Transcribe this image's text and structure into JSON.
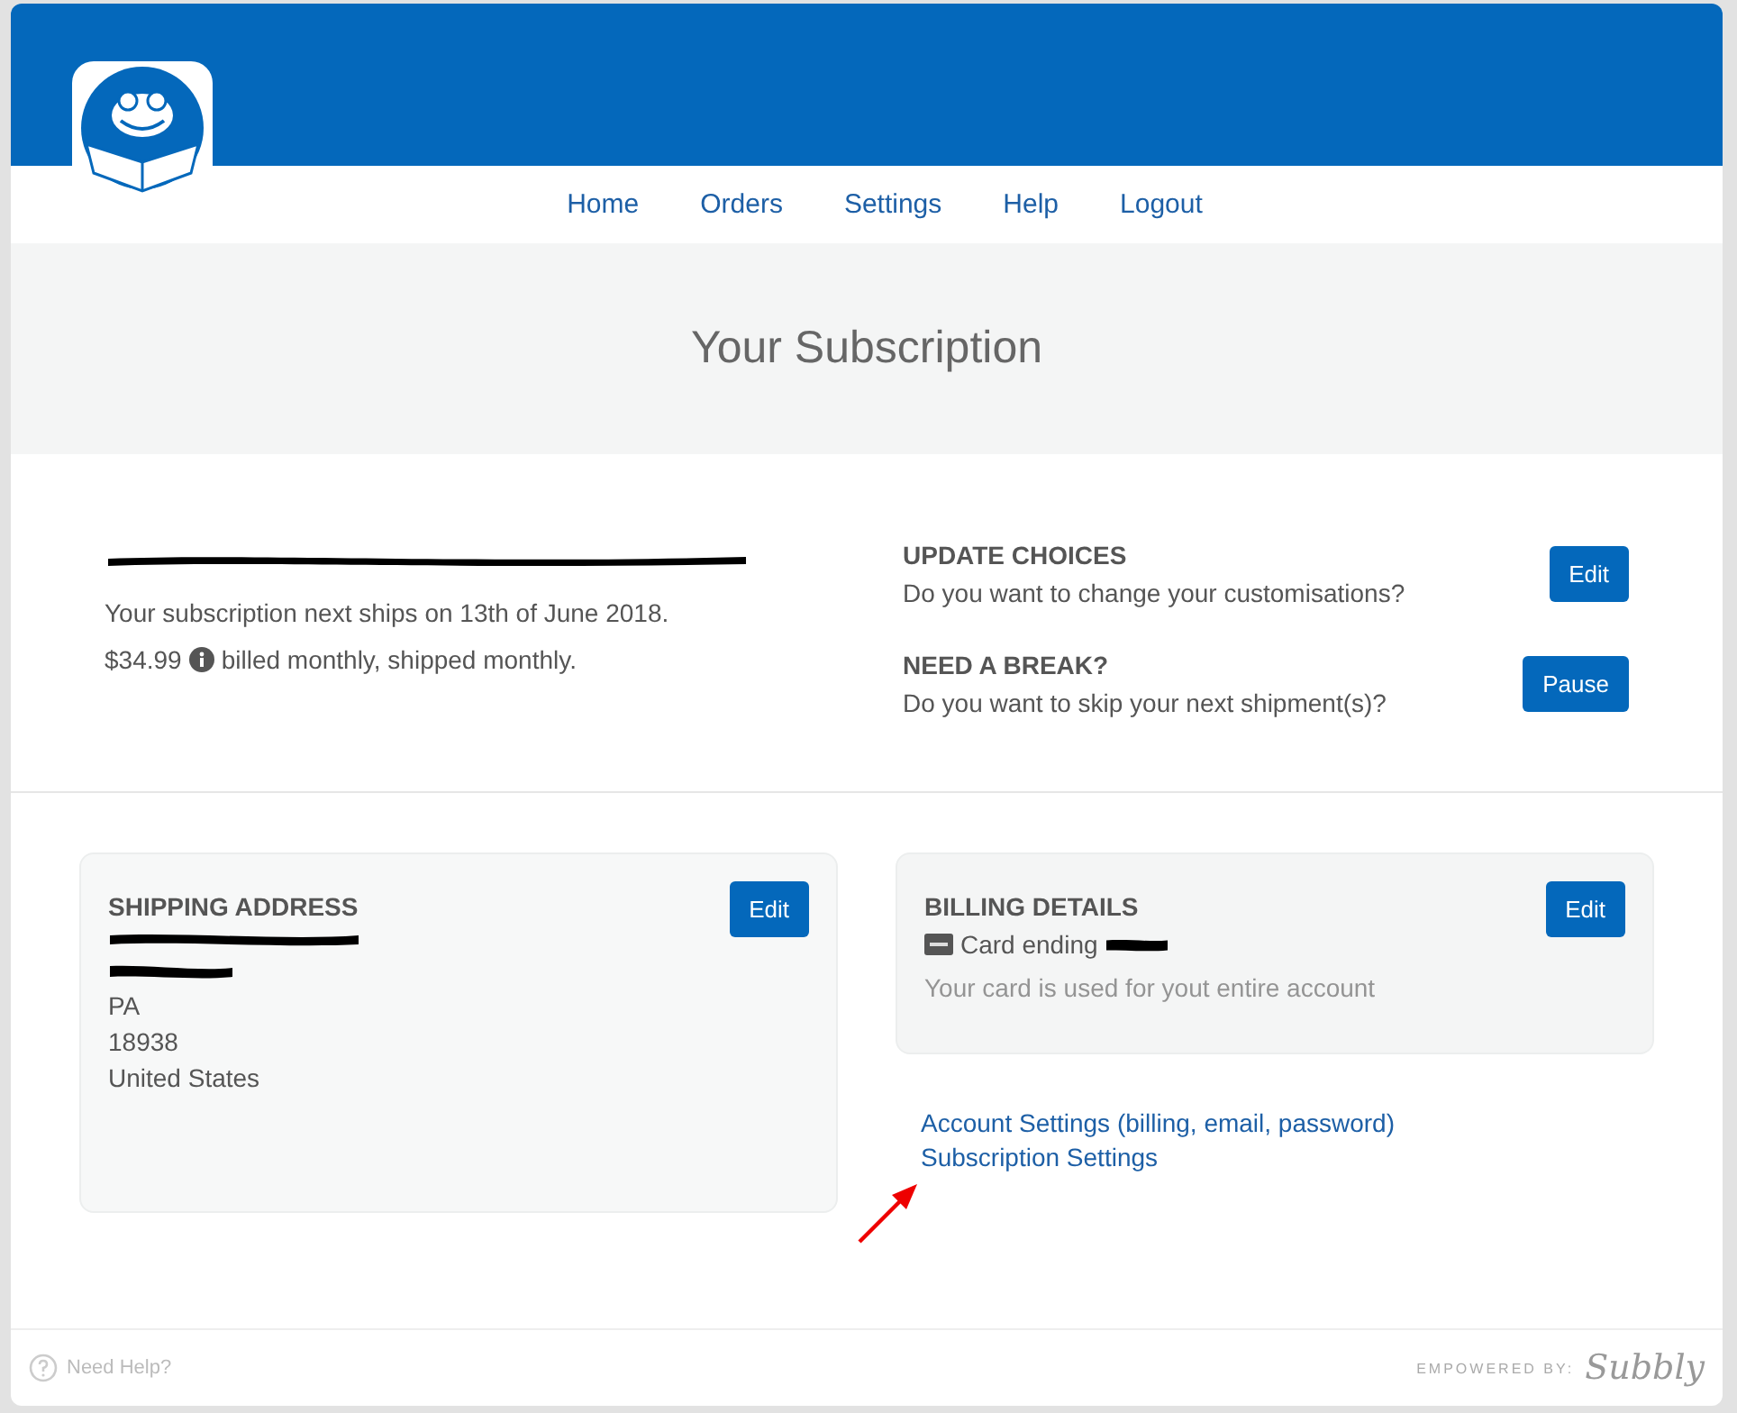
{
  "nav": [
    {
      "label": "Home"
    },
    {
      "label": "Orders"
    },
    {
      "label": "Settings"
    },
    {
      "label": "Help"
    },
    {
      "label": "Logout"
    }
  ],
  "page_title": "Your Subscription",
  "subscription": {
    "next_ship": "Your subscription next ships on 13th of June 2018.",
    "price": "$34.99",
    "billing": "billed monthly, shipped monthly."
  },
  "actions": [
    {
      "heading": "UPDATE CHOICES",
      "question": "Do you want to change your customisations?",
      "button": "Edit"
    },
    {
      "heading": "NEED A BREAK?",
      "question": "Do you want to skip your next shipment(s)?",
      "button": "Pause"
    }
  ],
  "shipping": {
    "heading": "SHIPPING ADDRESS",
    "button": "Edit",
    "lines": [
      "PA",
      "18938",
      "United States"
    ]
  },
  "billing": {
    "heading": "BILLING DETAILS",
    "button": "Edit",
    "card": "Card ending",
    "note": "Your card is used for yout entire account"
  },
  "links": [
    "Account Settings (billing, email, password)",
    "Subscription Settings"
  ],
  "footer": {
    "help": "Need Help?",
    "powered": "EMPOWERED BY:",
    "brand": "Subbly"
  }
}
